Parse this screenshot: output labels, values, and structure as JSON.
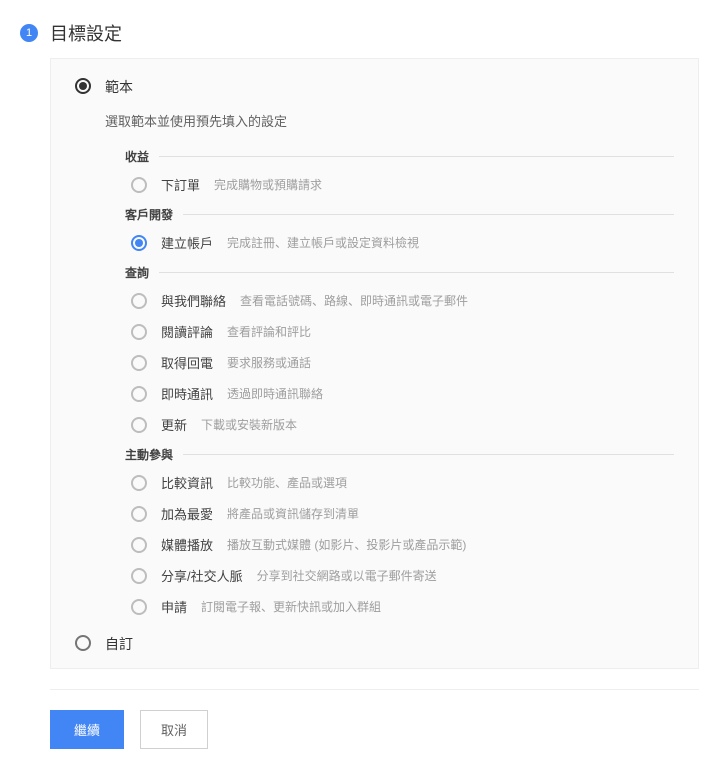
{
  "step": {
    "number": "1",
    "title": "目標設定"
  },
  "main_options": {
    "template": "範本",
    "custom": "自訂"
  },
  "subtitle": "選取範本並使用預先填入的設定",
  "groups": [
    {
      "title": "收益",
      "items": [
        {
          "label": "下訂單",
          "desc": "完成購物或預購請求",
          "selected": false
        }
      ]
    },
    {
      "title": "客戶開發",
      "items": [
        {
          "label": "建立帳戶",
          "desc": "完成註冊、建立帳戶或設定資料檢視",
          "selected": true
        }
      ]
    },
    {
      "title": "查詢",
      "items": [
        {
          "label": "與我們聯絡",
          "desc": "查看電話號碼、路線、即時通訊或電子郵件",
          "selected": false
        },
        {
          "label": "閱讀評論",
          "desc": "查看評論和評比",
          "selected": false
        },
        {
          "label": "取得回電",
          "desc": "要求服務或通話",
          "selected": false
        },
        {
          "label": "即時通訊",
          "desc": "透過即時通訊聯絡",
          "selected": false
        },
        {
          "label": "更新",
          "desc": "下載或安裝新版本",
          "selected": false
        }
      ]
    },
    {
      "title": "主動參與",
      "items": [
        {
          "label": "比較資訊",
          "desc": "比較功能、產品或選項",
          "selected": false
        },
        {
          "label": "加為最愛",
          "desc": "將產品或資訊儲存到清單",
          "selected": false
        },
        {
          "label": "媒體播放",
          "desc": "播放互動式媒體 (如影片、投影片或產品示範)",
          "selected": false
        },
        {
          "label": "分享/社交人脈",
          "desc": "分享到社交網路或以電子郵件寄送",
          "selected": false
        },
        {
          "label": "申請",
          "desc": "訂閱電子報、更新快訊或加入群組",
          "selected": false
        }
      ]
    }
  ],
  "buttons": {
    "continue": "繼續",
    "cancel": "取消"
  }
}
